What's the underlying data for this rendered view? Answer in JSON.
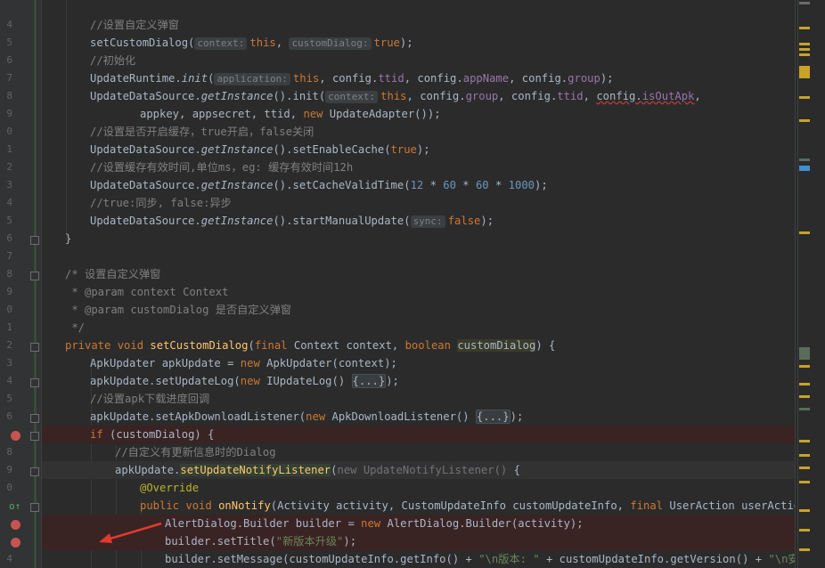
{
  "gutter": {
    "line_numbers": [
      "4",
      "5",
      "6",
      "7",
      "8",
      "9",
      "0",
      "1",
      "2",
      "3",
      "4",
      "5",
      "6",
      "7",
      "8",
      "9",
      "0",
      "1",
      "2",
      "3",
      "4",
      "5",
      "6",
      "7",
      "8",
      "9",
      "0",
      "1",
      "2",
      "3",
      "4",
      "5"
    ],
    "breakpoints_on_lines": [
      "if-customdialog",
      "alertdialog-builder",
      "set-title"
    ]
  },
  "code": {
    "l1": "//设置自定义弹窗",
    "l2_call": "setCustomDialog(",
    "l2_hint": "context:",
    "l2_this": "this",
    "l2_comma": ", ",
    "l2_hint2": "customDialog:",
    "l2_true": "true",
    "l2_end": ");",
    "l3": "//初始化",
    "l4_a": "UpdateRuntime.",
    "l4_init": "init",
    "l4_b": "(",
    "l4_hint": "application:",
    "l4_this": "this",
    "l4_c": ", config.",
    "l4_f1": "ttid",
    "l4_d": ", config.",
    "l4_f2": "appName",
    "l4_e": ", config.",
    "l4_f3": "group",
    "l4_f": ");",
    "l5_a": "UpdateDataSource.",
    "l5_gi": "getInstance",
    "l5_b": "().init(",
    "l5_hint": "context:",
    "l5_this": "this",
    "l5_c": ", config.",
    "l5_f1": "group",
    "l5_d": ", config.",
    "l5_f2": "ttid",
    "l5_e": ", ",
    "l5_cfg": "config",
    "l5_dot": ".",
    "l5_f3": "isOutApk",
    "l5_f": ",",
    "l6_a": "appkey, appsecret, ttid, ",
    "l6_new": "new",
    "l6_b": " UpdateAdapter());",
    "l7": "//设置是否开启缓存，true开启，false关闭",
    "l8_a": "UpdateDataSource.",
    "l8_gi": "getInstance",
    "l8_b": "().setEnableCache(",
    "l8_true": "true",
    "l8_c": ");",
    "l9": "//设置缓存有效时间,单位ms，eg: 缓存有效时间12h",
    "l10_a": "UpdateDataSource.",
    "l10_gi": "getInstance",
    "l10_b": "().setCacheValidTime(",
    "l10_n1": "12",
    "l10_s1": " * ",
    "l10_n2": "60",
    "l10_s2": " * ",
    "l10_n3": "60",
    "l10_s3": " * ",
    "l10_n4": "1000",
    "l10_c": ");",
    "l11": "//true:同步, false:异步",
    "l12_a": "UpdateDataSource.",
    "l12_gi": "getInstance",
    "l12_b": "().startManualUpdate(",
    "l12_hint": "sync:",
    "l12_false": "false",
    "l12_c": ");",
    "l13": "}",
    "l15": "/* 设置自定义弹窗",
    "l16": " * @param context Context",
    "l17": " * @param customDialog 是否自定义弹窗",
    "l18": " */",
    "l19_private": "private",
    "l19_void": "void",
    "l19_name": "setCustomDialog",
    "l19_a": "(",
    "l19_final": "final",
    "l19_b": " Context context, ",
    "l19_bool": "boolean",
    "l19_param": "customDialog",
    "l19_c": ") {",
    "l20_a": "ApkUpdater apkUpdate = ",
    "l20_new": "new",
    "l20_b": " ApkUpdater(context);",
    "l21_a": "apkUpdate.setUpdateLog(",
    "l21_new": "new",
    "l21_b": " IUpdateLog() ",
    "l21_fold": "{...}",
    "l21_c": ");",
    "l22": "//设置apk下载进度回调",
    "l23_a": "apkUpdate.setApkDownloadListener(",
    "l23_new": "new",
    "l23_b": " ApkDownloadListener() ",
    "l23_fold": "{...}",
    "l23_c": ");",
    "l24_if": "if",
    "l24_a": " (customDialog) {",
    "l25": "//自定义有更新信息时的Dialog",
    "l26_a": "apkUpdate.",
    "l26_fn": "setUpdateNotifyListener",
    "l26_b": "(",
    "l26_dim": "new UpdateNotifyListener()",
    "l26_c": " {",
    "l27": "@Override",
    "l28_public": "public",
    "l28_void": "void",
    "l28_name": "onNotify",
    "l28_a": "(Activity activity, CustomUpdateInfo customUpdateInfo, ",
    "l28_final": "final",
    "l28_b": " UserAction userAction) {",
    "l29_a": "AlertDialog.Builder builder = ",
    "l29_new": "new",
    "l29_b": " AlertDialog.Builder(activity);",
    "l30_a": "builder.setTitle(",
    "l30_str": "\"新版本升级\"",
    "l30_b": ");",
    "l31_a": "builder.setMessage(customUpdateInfo.getInfo() + ",
    "l31_s1": "\"\\n版本: \"",
    "l31_b": " + customUpdateInfo.getVersion() + ",
    "l31_s2": "\"\\n安装包大小"
  },
  "colors": {
    "background": "#2b2b2b",
    "keyword": "#cc7832",
    "string": "#6a8759",
    "comment": "#808080",
    "number": "#6897bb",
    "method_decl": "#ffc66d",
    "annotation": "#bbb529",
    "breakpoint": "#c75450",
    "arrow": "#e03a2e"
  },
  "icons": [
    "breakpoint-icon",
    "fold-marker-icon",
    "override-indicator-icon",
    "red-arrow-annotation"
  ]
}
